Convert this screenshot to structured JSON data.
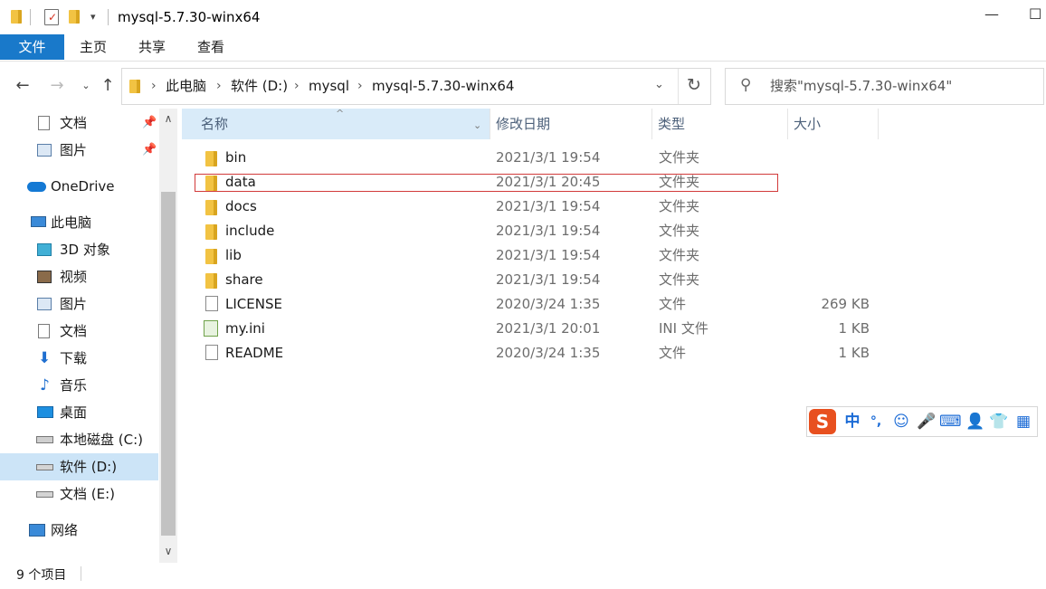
{
  "window": {
    "title": "mysql-5.7.30-winx64",
    "minimize_glyph": "—",
    "maximize_glyph": "☐"
  },
  "ribbon": {
    "tabs": [
      "文件",
      "主页",
      "共享",
      "查看"
    ],
    "active_color": "#1979ca"
  },
  "address": {
    "crumbs": [
      "此电脑",
      "软件 (D:)",
      "mysql",
      "mysql-5.7.30-winx64"
    ],
    "search_placeholder": "搜索\"mysql-5.7.30-winx64\""
  },
  "sidebar": {
    "items": [
      {
        "label": "文档",
        "icon": "documents-icon",
        "pinned": true
      },
      {
        "label": "图片",
        "icon": "pictures-icon",
        "pinned": true
      },
      {
        "label": "OneDrive",
        "icon": "onedrive-icon"
      },
      {
        "label": "此电脑",
        "icon": "this-pc-icon"
      },
      {
        "label": "3D 对象",
        "icon": "3d-objects-icon"
      },
      {
        "label": "视频",
        "icon": "videos-icon"
      },
      {
        "label": "图片",
        "icon": "pictures-icon"
      },
      {
        "label": "文档",
        "icon": "documents-icon"
      },
      {
        "label": "下载",
        "icon": "downloads-icon"
      },
      {
        "label": "音乐",
        "icon": "music-icon"
      },
      {
        "label": "桌面",
        "icon": "desktop-icon"
      },
      {
        "label": "本地磁盘 (C:)",
        "icon": "local-disk-icon"
      },
      {
        "label": "软件 (D:)",
        "icon": "drive-icon",
        "selected": true
      },
      {
        "label": "文档 (E:)",
        "icon": "drive-icon"
      },
      {
        "label": "网络",
        "icon": "network-icon"
      }
    ]
  },
  "columns": {
    "name": "名称",
    "date": "修改日期",
    "type": "类型",
    "size": "大小"
  },
  "files": [
    {
      "name": "bin",
      "date": "2021/3/1 19:54",
      "type": "文件夹",
      "size": "",
      "icon": "folder-icon"
    },
    {
      "name": "data",
      "date": "2021/3/1 20:45",
      "type": "文件夹",
      "size": "",
      "icon": "folder-icon",
      "highlighted": true
    },
    {
      "name": "docs",
      "date": "2021/3/1 19:54",
      "type": "文件夹",
      "size": "",
      "icon": "folder-icon"
    },
    {
      "name": "include",
      "date": "2021/3/1 19:54",
      "type": "文件夹",
      "size": "",
      "icon": "folder-icon"
    },
    {
      "name": "lib",
      "date": "2021/3/1 19:54",
      "type": "文件夹",
      "size": "",
      "icon": "folder-icon"
    },
    {
      "name": "share",
      "date": "2021/3/1 19:54",
      "type": "文件夹",
      "size": "",
      "icon": "folder-icon"
    },
    {
      "name": "LICENSE",
      "date": "2020/3/24 1:35",
      "type": "文件",
      "size": "269 KB",
      "icon": "file-icon"
    },
    {
      "name": "my.ini",
      "date": "2021/3/1 20:01",
      "type": "INI 文件",
      "size": "1 KB",
      "icon": "ini-file-icon"
    },
    {
      "name": "README",
      "date": "2020/3/24 1:35",
      "type": "文件",
      "size": "1 KB",
      "icon": "file-icon"
    }
  ],
  "ime_toolbar": {
    "mode": "中",
    "punct": "°,"
  },
  "status": {
    "count": "9 个项目"
  }
}
